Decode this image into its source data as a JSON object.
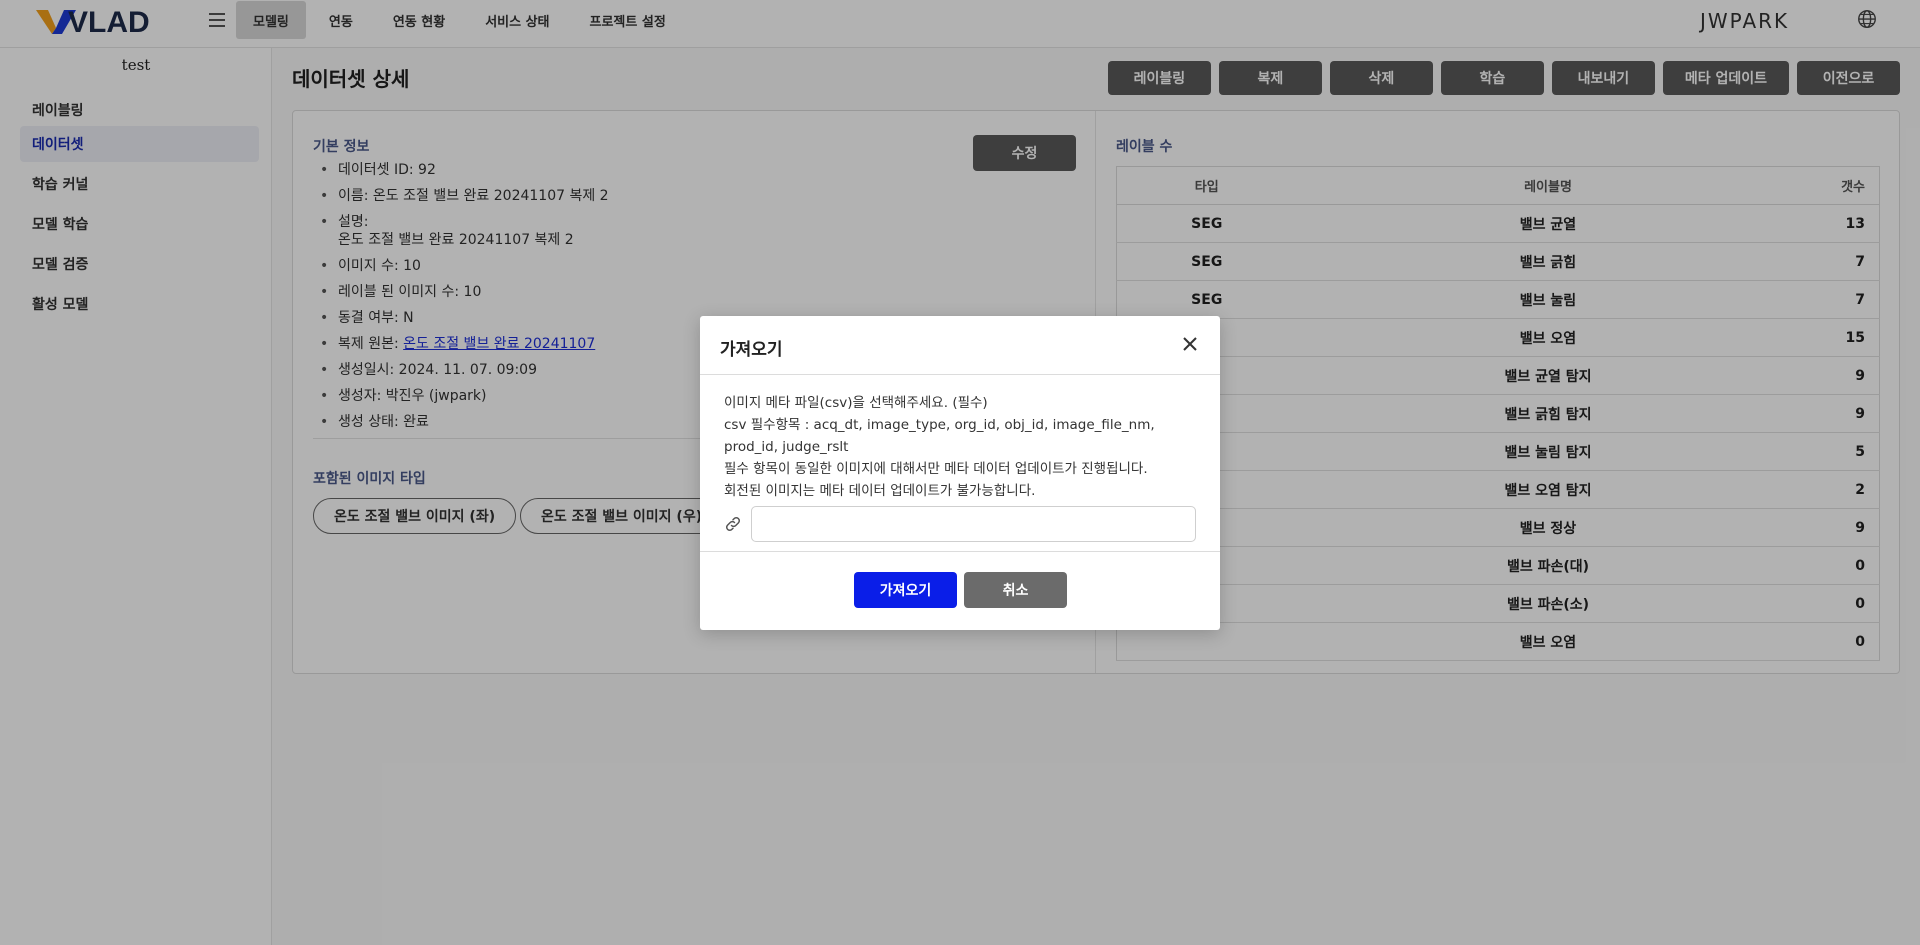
{
  "header": {
    "logo_text": "VLAD",
    "nav": [
      "모델링",
      "연동",
      "연동 현황",
      "서비스 상태",
      "프로젝트 설정"
    ],
    "active_nav": "모델링",
    "user": "JWPARK",
    "colors": {
      "brand_v_left": "#f2a01c",
      "brand_v_right": "#1e3ad6",
      "brand_text": "#1e2a4a"
    }
  },
  "sidebar": {
    "project": "test",
    "items": [
      "레이블링",
      "데이터셋",
      "학습 커널",
      "모델 학습",
      "모델 검증",
      "활성 모델"
    ],
    "active": "데이터셋"
  },
  "page": {
    "title": "데이터셋 상세",
    "actions": [
      "레이블링",
      "복제",
      "삭제",
      "학습",
      "내보내기",
      "메타 업데이트",
      "이전으로"
    ]
  },
  "basic_info": {
    "label": "기본 정보",
    "edit": "수정",
    "items": [
      "데이터셋 ID: 92",
      "이름: 온도 조절 밸브 완료 20241107 복제 2",
      "설명:",
      "온도 조절 밸브 완료 20241107 복제 2",
      "이미지 수: 10",
      "레이블 된 이미지 수: 10",
      "동결 여부: N",
      "복제 원본: ",
      "온도 조절 밸브 완료 20241107",
      "생성일시: 2024. 11. 07. 09:09",
      "생성자: 박진우 (jwpark)",
      "생성 상태: 완료"
    ]
  },
  "image_types": {
    "label": "포함된 이미지 타입",
    "chips": [
      "온도 조절 밸브 이미지 (좌)",
      "온도 조절 밸브 이미지 (우)"
    ]
  },
  "labels": {
    "label": "레이블 수",
    "headers": [
      "타입",
      "레이블명",
      "갯수"
    ],
    "rows": [
      [
        "SEG",
        "밸브 균열",
        "13"
      ],
      [
        "SEG",
        "밸브 긁힘",
        "7"
      ],
      [
        "SEG",
        "밸브 눌림",
        "7"
      ],
      [
        "",
        "밸브 오염",
        "15"
      ],
      [
        "",
        "밸브 균열 탐지",
        "9"
      ],
      [
        "",
        "밸브 긁힘 탐지",
        "9"
      ],
      [
        "",
        "밸브 눌림 탐지",
        "5"
      ],
      [
        "",
        "밸브 오염 탐지",
        "2"
      ],
      [
        "",
        "밸브 정상",
        "9"
      ],
      [
        "",
        "밸브 파손(대)",
        "0"
      ],
      [
        "",
        "밸브 파손(소)",
        "0"
      ],
      [
        "",
        "밸브 오염",
        "0"
      ]
    ]
  },
  "modal": {
    "title": "가져오기",
    "lines": [
      "이미지 메타 파일(csv)을 선택해주세요. (필수)",
      "csv 필수항목 : acq_dt, image_type, org_id, obj_id, image_file_nm, prod_id, judge_rslt",
      "필수 항목이 동일한 이미지에 대해서만 메타 데이터 업데이트가 진행됩니다.",
      "회전된 이미지는 메타 데이터 업데이트가 불가능합니다."
    ],
    "input_value": "",
    "confirm": "가져오기",
    "cancel": "취소",
    "colors": {
      "confirm": "#0a1ee8",
      "cancel": "#6b6b6b"
    }
  }
}
